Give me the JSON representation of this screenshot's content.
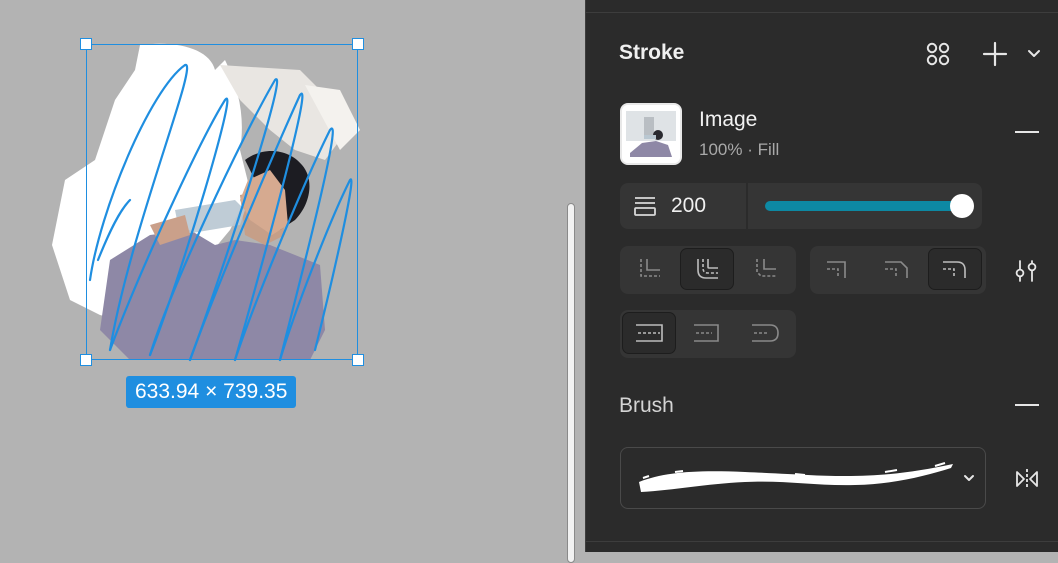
{
  "canvas": {
    "dimensions_label": "633.94 × 739.35"
  },
  "stroke": {
    "title": "Stroke",
    "fill": {
      "name": "Image",
      "details": "100% · Fill"
    },
    "width_value": "200",
    "width_slider_fraction": 0.97
  },
  "brush": {
    "title": "Brush"
  },
  "icons": [
    "styles-grid-icon",
    "add-icon",
    "chevron-down-icon",
    "remove-icon",
    "stroke-width-icon",
    "join-miter-icon",
    "join-round-icon",
    "join-bevel-icon",
    "cap-none-icon",
    "cap-square-icon",
    "cap-round-icon",
    "align-inside-icon",
    "align-center-icon",
    "align-outside-icon",
    "adjust-icon",
    "flip-horizontal-icon"
  ],
  "colors": {
    "accent": "#1f8ee0",
    "slider": "#0d89a3",
    "panel_bg": "#2b2b2b"
  }
}
